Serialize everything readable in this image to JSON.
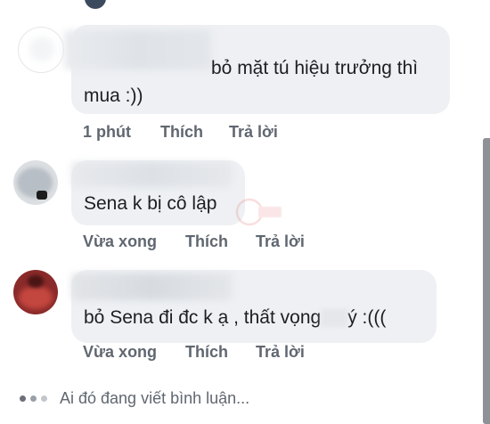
{
  "comments": [
    {
      "text_line1": "bỏ mặt tú hiệu trưởng thì",
      "text_line2": "mua :))",
      "time": "1 phút",
      "like": "Thích",
      "reply": "Trả lời"
    },
    {
      "text_line1": "Sena k bị cô lập",
      "text_line2": "",
      "time": "Vừa xong",
      "like": "Thích",
      "reply": "Trả lời"
    },
    {
      "text_line1": "bỏ Sena đi đc k ạ , thất vọng",
      "text_line1_tail": "ý :(((",
      "time": "Vừa xong",
      "like": "Thích",
      "reply": "Trả lời"
    }
  ],
  "typing": {
    "text": "Ai đó đang viết bình luận..."
  }
}
